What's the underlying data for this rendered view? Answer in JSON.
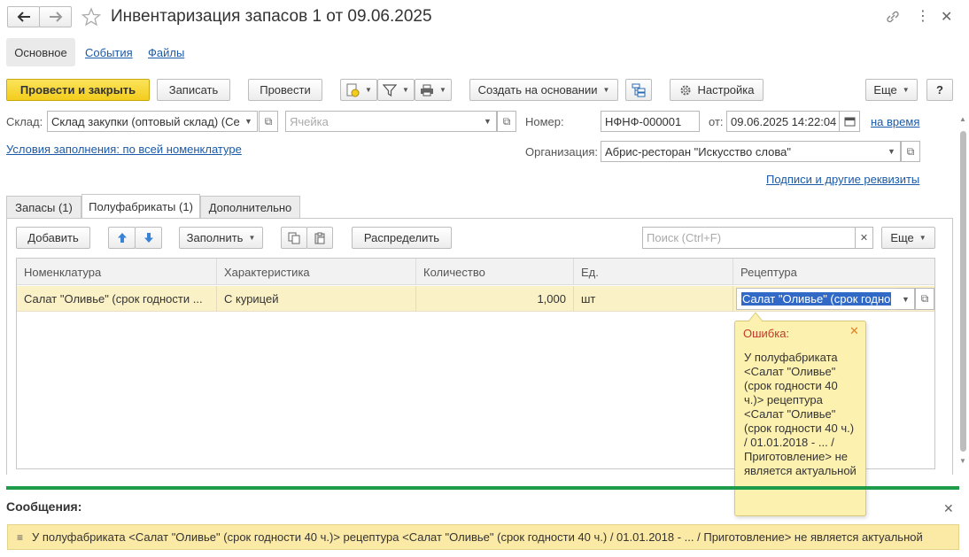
{
  "window": {
    "title": "Инвентаризация запасов 1 от 09.06.2025"
  },
  "nav_tabs": [
    {
      "label": "Основное"
    },
    {
      "label": "События"
    },
    {
      "label": "Файлы"
    }
  ],
  "toolbar": {
    "post_close": "Провести и закрыть",
    "save": "Записать",
    "post": "Провести",
    "create_based": "Создать на основании",
    "settings": "Настройка",
    "more": "Еще",
    "help": "?"
  },
  "form": {
    "warehouse_label": "Склад:",
    "warehouse_value": "Склад закупки (оптовый склад) (Се",
    "cell_placeholder": "Ячейка",
    "number_label": "Номер:",
    "number_value": "НФНФ-000001",
    "date_label": "от:",
    "date_value": "09.06.2025 14:22:04",
    "time_link": "на время",
    "fill_conditions_link": "Условия заполнения: по всей номенклатуре",
    "org_label": "Организация:",
    "org_value": "Абрис-ресторан \"Искусство слова\"",
    "signatures_link": "Подписи и другие реквизиты"
  },
  "doc_tabs": [
    {
      "label": "Запасы (1)"
    },
    {
      "label": "Полуфабрикаты (1)"
    },
    {
      "label": "Дополнительно"
    }
  ],
  "table_toolbar": {
    "add": "Добавить",
    "fill": "Заполнить",
    "distribute": "Распределить",
    "search_placeholder": "Поиск (Ctrl+F)",
    "more": "Еще"
  },
  "table": {
    "columns": [
      "Номенклатура",
      "Характеристика",
      "Количество",
      "Ед.",
      "Рецептура"
    ],
    "rows": [
      {
        "nomenclature": "Салат \"Оливье\" (срок годности ...",
        "characteristic": "С курицей",
        "quantity": "1,000",
        "unit": "шт",
        "recipe": "Салат \"Оливье\" (срок годно"
      }
    ]
  },
  "error_popup": {
    "title": "Ошибка:",
    "lines": [
      "У полуфабриката",
      "<Салат \"Оливье\"",
      "(срок годности 40",
      "ч.)> рецептура",
      "<Салат \"Оливье\"",
      "(срок годности 40 ч.)",
      "/ 01.01.2018 - ... /",
      "Приготовление> не",
      "является актуальной"
    ]
  },
  "messages": {
    "title": "Сообщения:",
    "items": [
      {
        "text": "У полуфабриката <Салат \"Оливье\" (срок годности 40 ч.)> рецептура <Салат \"Оливье\" (срок годности 40 ч.) / 01.01.2018 - ... / Приготовление> не является актуальной"
      }
    ]
  },
  "colors": {
    "accent_yellow": "#f3cd1d",
    "link_blue": "#1a5aa8",
    "error_bg": "#fdf1b0",
    "message_bar": "#fbe9a6",
    "separator_green": "#1e9c4a"
  }
}
